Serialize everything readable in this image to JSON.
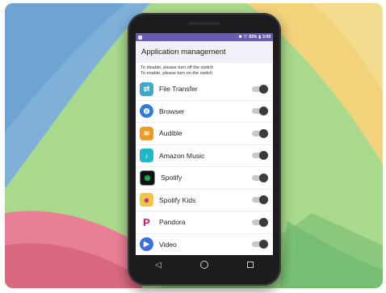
{
  "status_bar": {
    "battery": "83%",
    "time": "3:09"
  },
  "title": "Application management",
  "hint_lines": [
    "To disable, please turn off the switch",
    "To enable, please turn on the switch"
  ],
  "apps": [
    {
      "name": "File Transfer",
      "icon": "file-transfer-icon",
      "color": "#3fa9c9"
    },
    {
      "name": "Browser",
      "icon": "browser-icon",
      "color": "#2d7fd3"
    },
    {
      "name": "Audible",
      "icon": "audible-icon",
      "color": "#f29c1f"
    },
    {
      "name": "Amazon Music",
      "icon": "amazon-music-icon",
      "color": "#20b8c9"
    },
    {
      "name": "Spotify",
      "icon": "spotify-icon",
      "color": "#1db954"
    },
    {
      "name": "Spotify Kids",
      "icon": "spotify-kids-icon",
      "color": "#f4c542"
    },
    {
      "name": "Pandora",
      "icon": "pandora-icon",
      "color": "#d4146b"
    },
    {
      "name": "Video",
      "icon": "video-icon",
      "color": "#3a6fe0"
    }
  ],
  "colors": {
    "status_bar": "#6b5bb0",
    "title_bar": "#f1eff7",
    "toggle_knob": "#3b3b3b"
  }
}
